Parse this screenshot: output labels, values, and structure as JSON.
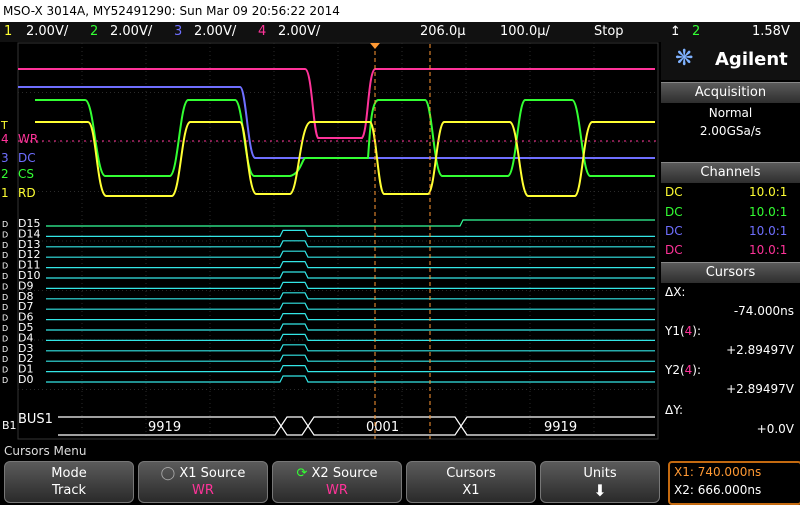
{
  "title": "MSO-X 3014A, MY52491290: Sun Mar 09 20:56:22 2014",
  "channel_bar": {
    "ch1": {
      "num": "1",
      "scale": "2.00V/",
      "color": "#ffff33"
    },
    "ch2": {
      "num": "2",
      "scale": "2.00V/",
      "color": "#33ff33"
    },
    "ch3": {
      "num": "3",
      "scale": "2.00V/",
      "color": "#6f6fff"
    },
    "ch4": {
      "num": "4",
      "scale": "2.00V/",
      "color": "#ff3399"
    },
    "delay": "206.0µ",
    "timebase": "100.0µ/",
    "run_state": "Stop",
    "trigger_channel": "2",
    "trigger_level": "1.58V"
  },
  "brand": "Agilent",
  "acquisition": {
    "heading": "Acquisition",
    "mode": "Normal",
    "rate": "2.00GSa/s"
  },
  "channels": {
    "heading": "Channels",
    "rows": [
      {
        "coupling": "DC",
        "probe": "10.0:1",
        "color": "#ffff33"
      },
      {
        "coupling": "DC",
        "probe": "10.0:1",
        "color": "#33ff33"
      },
      {
        "coupling": "DC",
        "probe": "10.0:1",
        "color": "#6f6fff"
      },
      {
        "coupling": "DC",
        "probe": "10.0:1",
        "color": "#ff3399"
      }
    ]
  },
  "cursors": {
    "heading": "Cursors",
    "dx_label": "ΔX:",
    "dx_value": "-74.000ns",
    "y1_label_pre": "Y1(",
    "y1_ch": "4",
    "y1_label_post": "):",
    "y1_value": "+2.89497V",
    "y2_label_pre": "Y2(",
    "y2_ch": "4",
    "y2_label_post": "):",
    "y2_value": "+2.89497V",
    "dy_label": "ΔY:",
    "dy_value": "+0.0V"
  },
  "analog_labels": {
    "ch4": "WR",
    "ch3": "DC",
    "ch2": "CS",
    "ch1": "RD",
    "trigger_marker": "T"
  },
  "digital_labels": [
    "D15",
    "D14",
    "D13",
    "D12",
    "D11",
    "D10",
    "D9",
    "D8",
    "D7",
    "D6",
    "D5",
    "D4",
    "D3",
    "D2",
    "D1",
    "D0"
  ],
  "bus": {
    "label": "BUS1",
    "prefix": "B1",
    "values": [
      "9919",
      "0001",
      "9919"
    ]
  },
  "softkeys": {
    "menu_title": "Cursors Menu",
    "mode": {
      "label": "Mode",
      "value": "Track"
    },
    "x1_source": {
      "label": "X1 Source",
      "value": "WR"
    },
    "x2_source": {
      "label": "X2 Source",
      "value": "WR"
    },
    "cursors": {
      "label": "Cursors",
      "value": "X1"
    },
    "units": {
      "label": "Units"
    },
    "readout": {
      "x1": "X1: 740.000ns",
      "x2": "X2: 666.000ns"
    }
  }
}
